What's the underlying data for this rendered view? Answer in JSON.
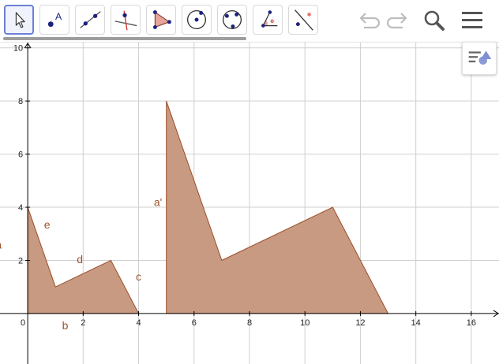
{
  "toolbar": {
    "tools": [
      {
        "name": "move-tool",
        "selected": true
      },
      {
        "name": "point-tool",
        "label": "A"
      },
      {
        "name": "line-tool"
      },
      {
        "name": "perpendicular-line-tool"
      },
      {
        "name": "polygon-tool"
      },
      {
        "name": "circle-center-point-tool"
      },
      {
        "name": "circle-three-points-tool"
      },
      {
        "name": "angle-tool"
      },
      {
        "name": "reflect-about-line-tool"
      }
    ],
    "controls": [
      "undo-icon",
      "redo-icon",
      "search-icon",
      "menu-icon"
    ]
  },
  "graphics": {
    "x_axis": {
      "min": -1.0,
      "max": 17.0,
      "ticks": [
        "0",
        "2",
        "4",
        "6",
        "8",
        "10",
        "12",
        "14",
        "16"
      ]
    },
    "y_axis": {
      "min": -1.9,
      "max": 10.2,
      "ticks": [
        "2",
        "4",
        "6",
        "8",
        "10"
      ]
    },
    "grid": true,
    "colors": {
      "polygon_fill": "#c89a82",
      "polygon_stroke": "#9c4e28",
      "label": "#a0522d",
      "grid": "#cfcfcf",
      "axis": "#000000"
    },
    "polygons": [
      {
        "name": "original-polygon",
        "points": [
          [
            0,
            0
          ],
          [
            0,
            4
          ],
          [
            1,
            1
          ],
          [
            3,
            2
          ],
          [
            4,
            0
          ]
        ]
      },
      {
        "name": "dilated-polygon",
        "points": [
          [
            5,
            0
          ],
          [
            5,
            8
          ],
          [
            7,
            2
          ],
          [
            11,
            4
          ],
          [
            13,
            0
          ]
        ]
      }
    ],
    "labels": [
      {
        "name": "label-a",
        "text": "a",
        "x": -1.05,
        "y": 2.45
      },
      {
        "name": "label-e",
        "text": "e",
        "x": 0.7,
        "y": 3.2
      },
      {
        "name": "label-d",
        "text": "d",
        "x": 1.88,
        "y": 1.9
      },
      {
        "name": "label-c",
        "text": "c",
        "x": 4.0,
        "y": 1.25
      },
      {
        "name": "label-b",
        "text": "b",
        "x": 1.35,
        "y": -0.6
      },
      {
        "name": "label-a-prime",
        "text": "a'",
        "x": 4.7,
        "y": 4.05
      }
    ]
  }
}
